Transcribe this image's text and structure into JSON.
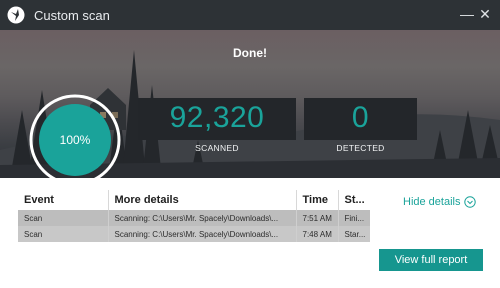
{
  "window": {
    "title": "Custom scan",
    "minimize_glyph": "—",
    "close_glyph": "✕"
  },
  "header": {
    "status": "Done!"
  },
  "progress": {
    "label": "100%",
    "percent": 100
  },
  "stats": {
    "scanned": {
      "value": "92,320",
      "label": "SCANNED"
    },
    "detected": {
      "value": "0",
      "label": "DETECTED"
    }
  },
  "details": {
    "columns": [
      "Event",
      "More details",
      "Time",
      "St..."
    ],
    "rows": [
      {
        "event": "Scan",
        "details": "Scanning: C:\\Users\\Mr. Spacely\\Downloads\\...",
        "time": "7:51 AM",
        "status": "Fini..."
      },
      {
        "event": "Scan",
        "details": "Scanning: C:\\Users\\Mr. Spacely\\Downloads\\...",
        "time": "7:48 AM",
        "status": "Star..."
      }
    ],
    "hide_label": "Hide details",
    "report_button": "View full report"
  },
  "colors": {
    "accent": "#1aa39a",
    "titlebar": "#2d3236",
    "stat_box": "#23262a"
  },
  "icons": {
    "app_logo": "app-logo-icon",
    "chevron": "chevron-down-circle-icon"
  }
}
